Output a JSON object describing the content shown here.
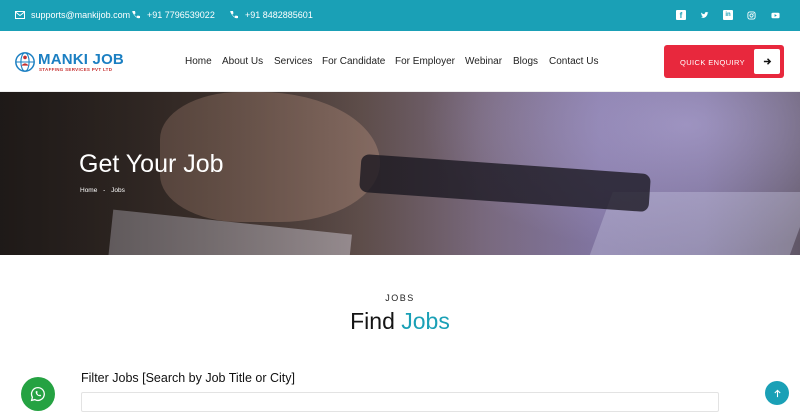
{
  "topbar": {
    "email": "supports@mankijob.com",
    "phone1": "+91 7796539022",
    "phone2": "+91 8482885601",
    "social_icons": [
      "facebook-icon",
      "twitter-icon",
      "linkedin-icon",
      "instagram-icon",
      "youtube-icon"
    ],
    "bg_color": "#1aa0b6"
  },
  "logo": {
    "brand": "MANKI JOB",
    "tagline": "STAFFING SERVICES PVT LTD"
  },
  "nav": {
    "items": [
      "Home",
      "About Us",
      "Services",
      "For Candidate",
      "For Employer",
      "Webinar",
      "Blogs",
      "Contact Us"
    ],
    "cta_label": "QUICK ENQUIRY",
    "cta_color": "#e8283d"
  },
  "hero": {
    "title": "Get Your Job",
    "breadcrumb_home": "Home",
    "breadcrumb_sep": "-",
    "breadcrumb_current": "Jobs"
  },
  "section": {
    "eyebrow": "JOBS",
    "title_main": "Find",
    "title_highlight": "Jobs",
    "accent_color": "#1aa0b6"
  },
  "filter": {
    "label": "Filter Jobs [Search by Job Title or City]"
  },
  "floating": {
    "whatsapp_icon": "whatsapp-icon",
    "scroll_top_icon": "arrow-up-icon"
  }
}
